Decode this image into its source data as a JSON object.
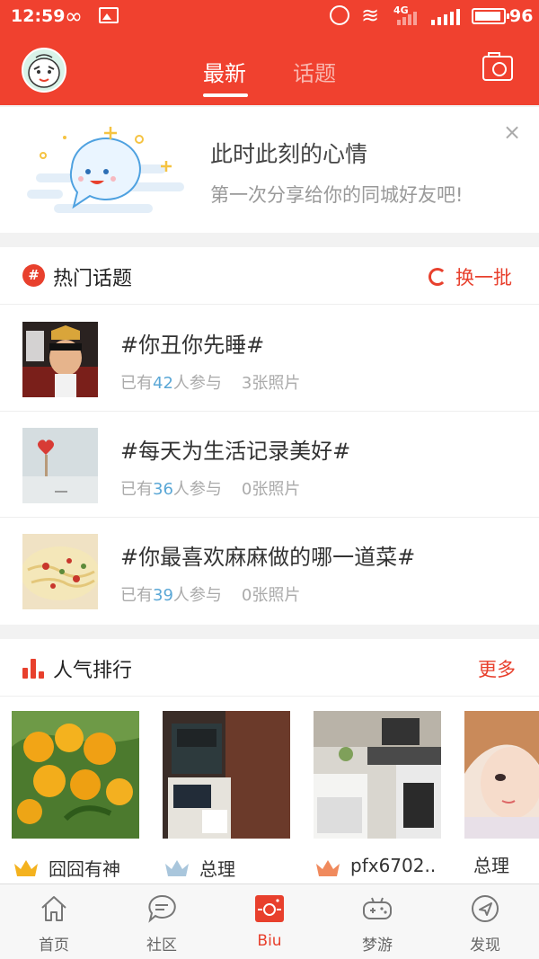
{
  "status_bar": {
    "time": "12:59",
    "battery_level": "96",
    "network": "4G"
  },
  "header": {
    "tabs": [
      {
        "label": "最新",
        "active": true
      },
      {
        "label": "话题",
        "active": false
      }
    ],
    "avatar_icon": "cartoon-face-avatar",
    "camera_icon": "camera-icon"
  },
  "mood_card": {
    "title": "此时此刻的心情",
    "subtitle": "第一次分享给你的同城好友吧!",
    "close_label": "×"
  },
  "hot_topics": {
    "header": "热门话题",
    "hash_icon_text": "#",
    "refresh_label": "换一批",
    "items": [
      {
        "title": "#你丑你先睡#",
        "count_prefix": "已有",
        "count": "42",
        "count_suffix": "人参与",
        "photos": "3张照片"
      },
      {
        "title": "#每天为生活记录美好#",
        "count_prefix": "已有",
        "count": "36",
        "count_suffix": "人参与",
        "photos": "0张照片"
      },
      {
        "title": "#你最喜欢麻麻做的哪一道菜#",
        "count_prefix": "已有",
        "count": "39",
        "count_suffix": "人参与",
        "photos": "0张照片"
      }
    ]
  },
  "ranking": {
    "header": "人气排行",
    "more_label": "更多",
    "items": [
      {
        "name": "囧囧有神",
        "crown": "1"
      },
      {
        "name": "总理",
        "crown": "2"
      },
      {
        "name": "pfx6702..",
        "crown": "3"
      },
      {
        "name": "总理",
        "crown": ""
      }
    ]
  },
  "bottom_nav": {
    "items": [
      {
        "label": "首页",
        "icon": "home-icon",
        "active": false
      },
      {
        "label": "社区",
        "icon": "chat-bubble-icon",
        "active": false
      },
      {
        "label": "Biu",
        "icon": "biu-camera-icon",
        "active": true
      },
      {
        "label": "梦游",
        "icon": "gamepad-icon",
        "active": false
      },
      {
        "label": "发现",
        "icon": "compass-icon",
        "active": false
      }
    ]
  },
  "colors": {
    "brand": "#f0412f",
    "accent_blue": "#5aa7d6"
  }
}
